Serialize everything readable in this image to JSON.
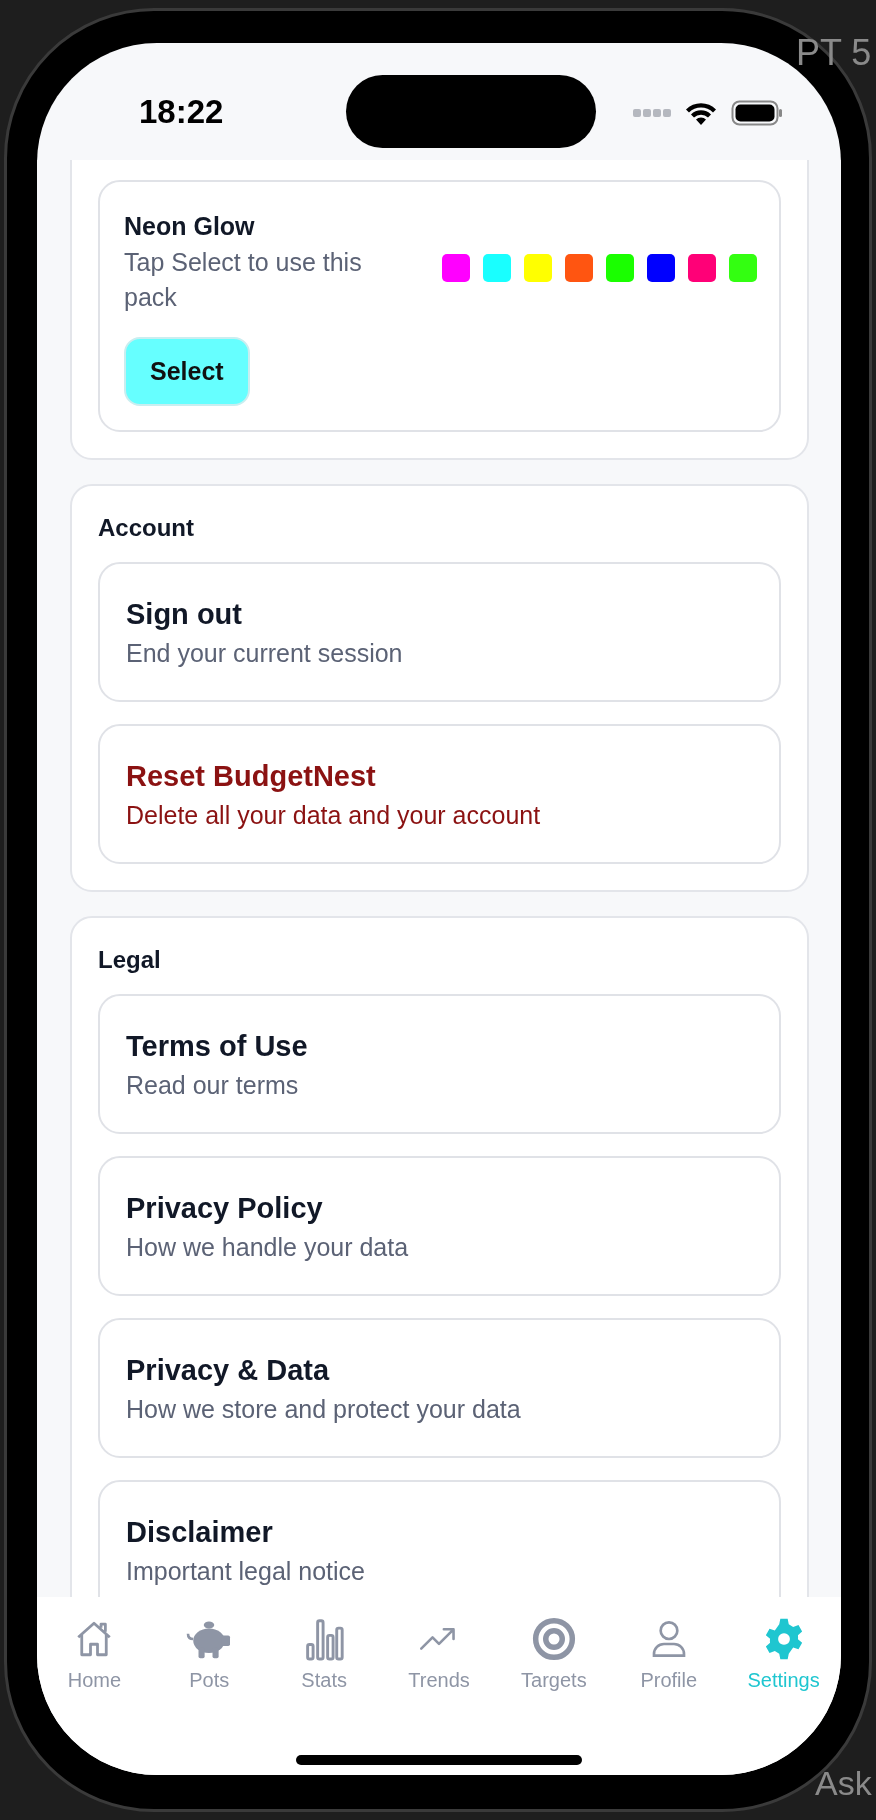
{
  "backdrop": {
    "top_text": "PT 5",
    "bottom_text": "Ask"
  },
  "status_bar": {
    "time": "18:22"
  },
  "theme_pack": {
    "name": "Neon Glow",
    "description": "Tap Select to use this pack",
    "button": "Select",
    "swatches": [
      {
        "color": "#ff00ff"
      },
      {
        "color": "#19ffff"
      },
      {
        "color": "#ffff00"
      },
      {
        "color": "#ff5511"
      },
      {
        "color": "#1aff00"
      },
      {
        "color": "#0000ff"
      },
      {
        "color": "#ff0077"
      },
      {
        "color": "#33ff11"
      }
    ]
  },
  "sections": [
    {
      "title": "Account",
      "items": [
        {
          "kind": "normal",
          "title": "Sign out",
          "subtitle": "End your current session"
        },
        {
          "kind": "danger",
          "title": "Reset BudgetNest",
          "subtitle": "Delete all your data and your account"
        }
      ]
    },
    {
      "title": "Legal",
      "items": [
        {
          "kind": "normal",
          "title": "Terms of Use",
          "subtitle": "Read our terms"
        },
        {
          "kind": "normal",
          "title": "Privacy Policy",
          "subtitle": "How we handle your data"
        },
        {
          "kind": "normal",
          "title": "Privacy & Data",
          "subtitle": "How we store and protect your data"
        },
        {
          "kind": "normal",
          "title": "Disclaimer",
          "subtitle": "Important legal notice"
        }
      ]
    }
  ],
  "tab_bar": [
    {
      "label": "Home",
      "selected": false
    },
    {
      "label": "Pots",
      "selected": false
    },
    {
      "label": "Stats",
      "selected": false
    },
    {
      "label": "Trends",
      "selected": false
    },
    {
      "label": "Targets",
      "selected": false
    },
    {
      "label": "Profile",
      "selected": false
    },
    {
      "label": "Settings",
      "selected": true
    }
  ]
}
